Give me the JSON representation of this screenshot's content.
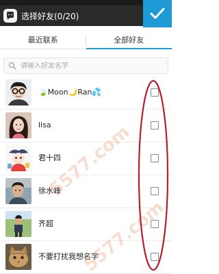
{
  "header": {
    "title": "选择好友(0/20)",
    "confirm_icon": "checkmark-icon",
    "app_icon": "message-bubble-icon"
  },
  "tabs": [
    {
      "label": "最近联系",
      "active": false
    },
    {
      "label": "全部好友",
      "active": true
    }
  ],
  "search": {
    "placeholder": "请输入好友名字"
  },
  "friends": [
    {
      "name": "🍃Moon🌙Ran💦",
      "checked": false
    },
    {
      "name": "lisa",
      "checked": false
    },
    {
      "name": "君十四",
      "checked": false
    },
    {
      "name": "徐水峰",
      "checked": false
    },
    {
      "name": "齐超",
      "checked": false
    },
    {
      "name": "不要打扰我想名字",
      "checked": false
    }
  ],
  "watermark_text": "5577.com",
  "colors": {
    "accent": "#1e9ad6",
    "topbar": "#2a2a2a",
    "annotation": "#b3202a"
  }
}
